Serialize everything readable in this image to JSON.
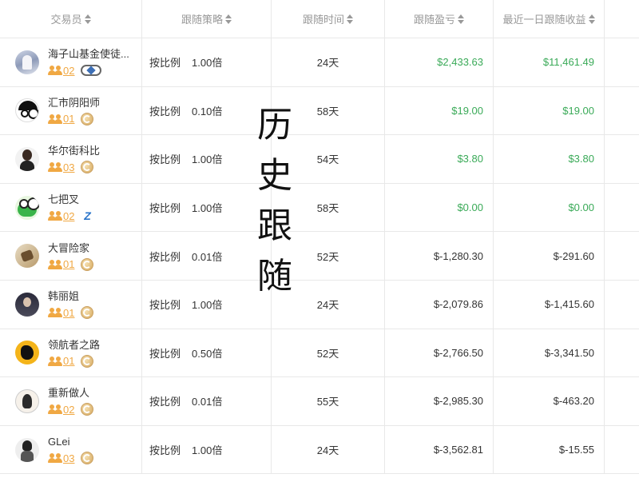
{
  "header": {
    "trader": "交易员",
    "strategy": "跟随策略",
    "time": "跟随时间",
    "pnl": "跟随盈亏",
    "daily": "最近一日跟随收益"
  },
  "overlay": [
    "历",
    "史",
    "跟",
    "随"
  ],
  "colors": {
    "positive": "#3aaa58",
    "negative": "#333333",
    "fans": "#f0a843"
  },
  "rows": [
    {
      "name": "海子山基金使徒...",
      "fans": "02",
      "badge": "vip-badge-icon",
      "mode": "按比例",
      "ratio": "1.00倍",
      "time": "24天",
      "pnl": "$2,433.63",
      "daily": "$11,461.49",
      "positive": true
    },
    {
      "name": "汇市阴阳师",
      "fans": "01",
      "badge": "gold-badge-icon",
      "mode": "按比例",
      "ratio": "0.10倍",
      "time": "58天",
      "pnl": "$19.00",
      "daily": "$19.00",
      "positive": true
    },
    {
      "name": "华尔街科比",
      "fans": "03",
      "badge": "gold-badge-icon",
      "mode": "按比例",
      "ratio": "1.00倍",
      "time": "54天",
      "pnl": "$3.80",
      "daily": "$3.80",
      "positive": true
    },
    {
      "name": "七把叉",
      "fans": "02",
      "badge": "blue-z-badge-icon",
      "mode": "按比例",
      "ratio": "1.00倍",
      "time": "58天",
      "pnl": "$0.00",
      "daily": "$0.00",
      "positive": true
    },
    {
      "name": "大冒险家",
      "fans": "01",
      "badge": "gold-badge-icon",
      "mode": "按比例",
      "ratio": "0.01倍",
      "time": "52天",
      "pnl": "$-1,280.30",
      "daily": "$-291.60",
      "positive": false
    },
    {
      "name": "韩丽姐",
      "fans": "01",
      "badge": "gold-badge-icon",
      "mode": "按比例",
      "ratio": "1.00倍",
      "time": "24天",
      "pnl": "$-2,079.86",
      "daily": "$-1,415.60",
      "positive": false
    },
    {
      "name": "领航者之路",
      "fans": "01",
      "badge": "gold-badge-icon",
      "mode": "按比例",
      "ratio": "0.50倍",
      "time": "52天",
      "pnl": "$-2,766.50",
      "daily": "$-3,341.50",
      "positive": false
    },
    {
      "name": "重新做人",
      "fans": "02",
      "badge": "gold-badge-icon",
      "mode": "按比例",
      "ratio": "0.01倍",
      "time": "55天",
      "pnl": "$-2,985.30",
      "daily": "$-463.20",
      "positive": false
    },
    {
      "name": "GLei",
      "fans": "03",
      "badge": "gold-badge-icon",
      "mode": "按比例",
      "ratio": "1.00倍",
      "time": "24天",
      "pnl": "$-3,562.81",
      "daily": "$-15.55",
      "positive": false
    }
  ]
}
